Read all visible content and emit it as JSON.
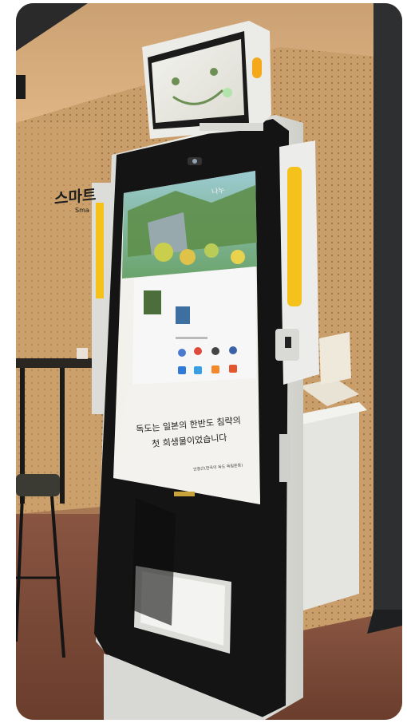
{
  "scene": {
    "wall_sign": "스마트",
    "wall_sign_sub": "Sma",
    "colors": {
      "wall": "#c9a16e",
      "ceiling": "#d6a978",
      "floor": "#7a4a36",
      "kiosk_body": "#e9e9e6",
      "kiosk_glass": "#141414",
      "accent_yellow": "#f4c21a",
      "dark_panel": "#2e2f30"
    }
  },
  "top_screen": {
    "face": "smiley-face"
  },
  "main_screen": {
    "header_text": "나누",
    "handwritten_line1": "독도는 일본의 한반도 침략의",
    "handwritten_line2": "첫 희생물이었습니다",
    "signature": "안중근(한국의 독도 독립운동)"
  },
  "icons": [
    "app-icon",
    "app-icon",
    "app-icon",
    "app-icon",
    "app-icon",
    "app-icon",
    "app-icon",
    "app-icon"
  ]
}
